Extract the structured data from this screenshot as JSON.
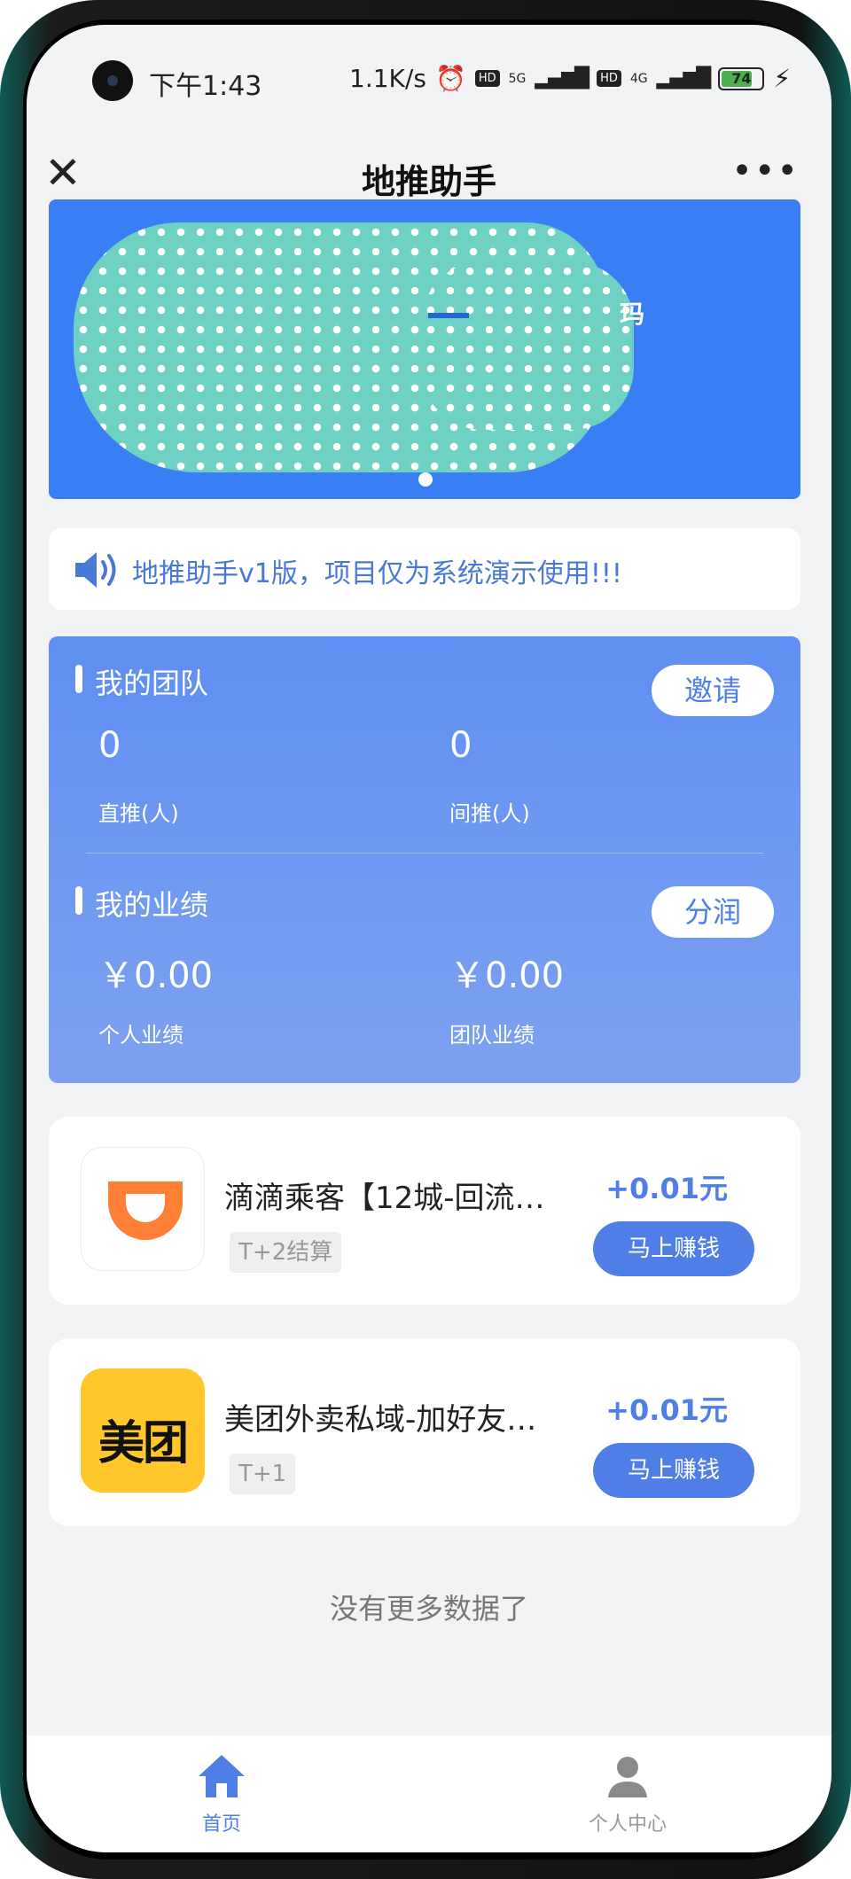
{
  "status_bar": {
    "time": "下午1:43",
    "net_speed": "1.1K/s",
    "hd": "HD",
    "net_5g": "5G",
    "net_4g": "4G",
    "battery": "74"
  },
  "nav": {
    "title": "地推助手",
    "more": "•••",
    "close": "✕"
  },
  "banner": {
    "partial_text": "玛"
  },
  "notice": {
    "text": "地推助手v1版，项目仅为系统演示使用!!!"
  },
  "team": {
    "title": "我的团队",
    "invite_label": "邀请",
    "direct_value": "0",
    "direct_label": "直推(人)",
    "indirect_value": "0",
    "indirect_label": "间推(人)"
  },
  "performance": {
    "title": "我的业绩",
    "share_label": "分润",
    "personal_value": "￥0.00",
    "personal_label": "个人业绩",
    "team_value": "￥0.00",
    "team_label": "团队业绩"
  },
  "products": [
    {
      "title": "滴滴乘客【12城-回流…",
      "tag": "T+2结算",
      "price": "+0.01元",
      "button": "马上赚钱",
      "logo_color": "#ff7f37"
    },
    {
      "title": "美团外卖私域-加好友…",
      "tag": "T+1",
      "price": "+0.01元",
      "button": "马上赚钱",
      "logo_text": "美团",
      "logo_color": "#ffc72c"
    }
  ],
  "footer_text": "没有更多数据了",
  "tabs": [
    {
      "label": "首页",
      "icon": "home-icon"
    },
    {
      "label": "个人中心",
      "icon": "user-icon"
    }
  ],
  "colors": {
    "accent": "#4f7ee6",
    "banner": "#3a7ef6"
  }
}
